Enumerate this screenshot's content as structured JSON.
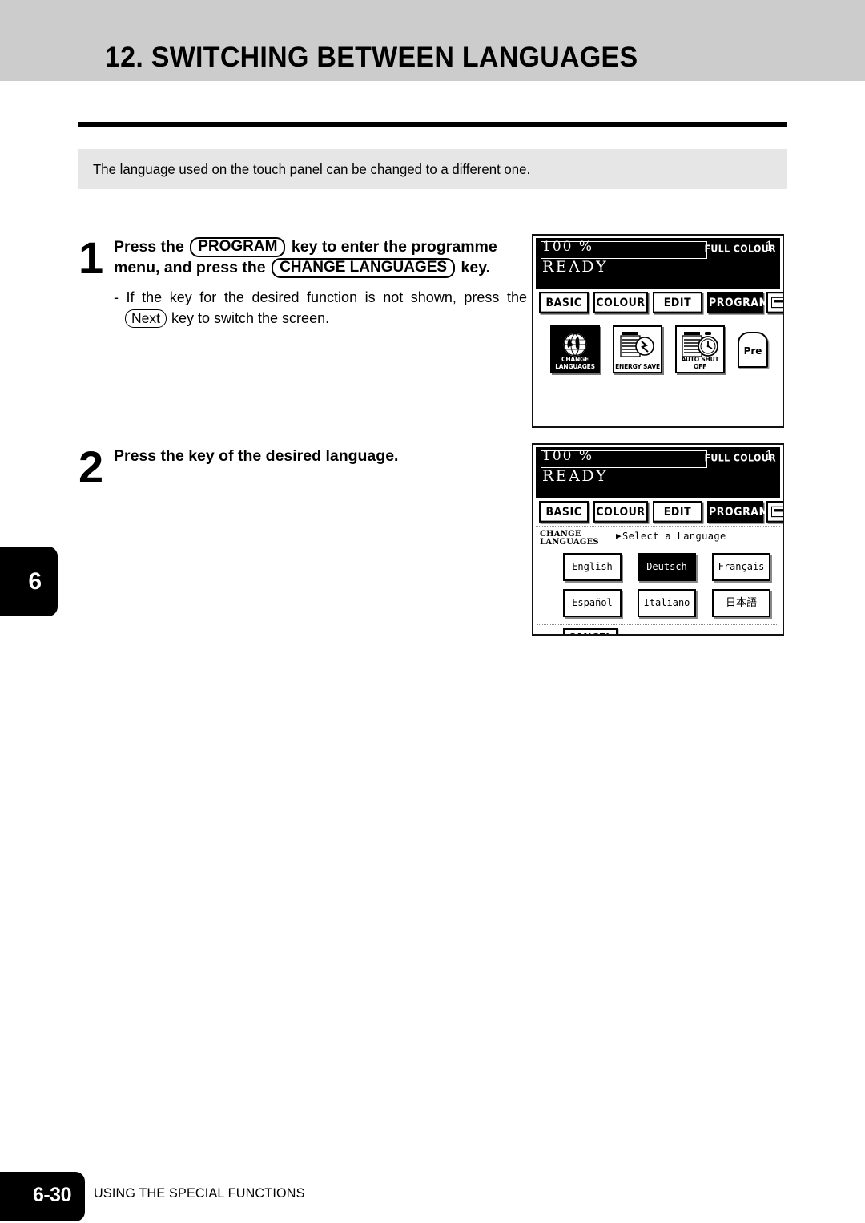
{
  "header": {
    "title": "12. SWITCHING BETWEEN LANGUAGES"
  },
  "intro": {
    "text": "The language used on the touch panel can be changed to a different one."
  },
  "steps": [
    {
      "number": "1",
      "head_line1_before": "Press the",
      "head_key1": "PROGRAM",
      "head_line1_after": "key to enter the programme",
      "head_line2_before": "menu, and press the",
      "head_key2": "CHANGE LANGUAGES",
      "head_line2_after": "key.",
      "sub_line1": "-  If the key for the desired function is not shown, press the",
      "sub_key": "Next",
      "sub_line2_after": "key to switch the screen."
    },
    {
      "number": "2",
      "head": "Press the key of the desired language."
    }
  ],
  "lcd1": {
    "ratio": "100  %",
    "copies": "1",
    "colour_mode": "FULL COLOUR",
    "status": "READY",
    "tabs": [
      {
        "label": "BASIC",
        "selected": false
      },
      {
        "label": "COLOUR",
        "selected": false
      },
      {
        "label": "EDIT",
        "selected": false
      },
      {
        "label": "PROGRAM",
        "selected": true
      }
    ],
    "keyboard_tab": "screen-keypad-icon",
    "functions": [
      {
        "label_line1": "CHANGE",
        "label_line2": "LANGUAGES",
        "icon": "globe-icon",
        "selected": true
      },
      {
        "label_line1": "ENERGY SAVE",
        "label_line2": "",
        "icon": "energy-save-icon",
        "selected": false
      },
      {
        "label_line1": "AUTO SHUT OFF",
        "label_line2": "",
        "icon": "auto-shut-off-icon",
        "selected": false
      }
    ],
    "next_tag": "Pre"
  },
  "lcd2": {
    "ratio": "100  %",
    "copies": "1",
    "colour_mode": "FULL COLOUR",
    "status": "READY",
    "tabs": [
      {
        "label": "BASIC",
        "selected": false
      },
      {
        "label": "COLOUR",
        "selected": false
      },
      {
        "label": "EDIT",
        "selected": false
      },
      {
        "label": "PROGRAM",
        "selected": true
      }
    ],
    "function_label_line1": "CHANGE",
    "function_label_line2": "LANGUAGES",
    "prompt": "Select a Language",
    "languages": [
      {
        "label": "English",
        "selected": false
      },
      {
        "label": "Deutsch",
        "selected": true
      },
      {
        "label": "Français",
        "selected": false
      },
      {
        "label": "Español",
        "selected": false
      },
      {
        "label": "Italiano",
        "selected": false
      },
      {
        "label": "日本語",
        "selected": false
      }
    ],
    "cancel_label": "CANCEL"
  },
  "chapter_tab": {
    "number": "6"
  },
  "footer": {
    "page": "6-30",
    "section": "USING THE SPECIAL FUNCTIONS"
  }
}
